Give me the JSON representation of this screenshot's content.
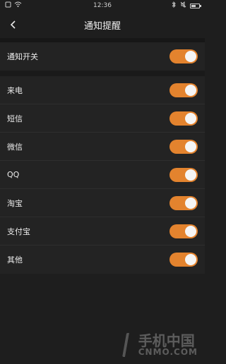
{
  "status": {
    "time": "12:36",
    "battery_level": 0.55
  },
  "header": {
    "title": "通知提醒"
  },
  "master_toggle": {
    "label": "通知开关",
    "on": true
  },
  "apps": [
    {
      "label": "来电",
      "on": true
    },
    {
      "label": "短信",
      "on": true
    },
    {
      "label": "微信",
      "on": true
    },
    {
      "label": "QQ",
      "on": true
    },
    {
      "label": "淘宝",
      "on": true
    },
    {
      "label": "支付宝",
      "on": true
    },
    {
      "label": "其他",
      "on": true
    }
  ],
  "watermark": {
    "cn": "手机中国",
    "en": "CNMO.COM"
  },
  "colors": {
    "accent": "#e3832e",
    "background": "#1e1e1e"
  }
}
